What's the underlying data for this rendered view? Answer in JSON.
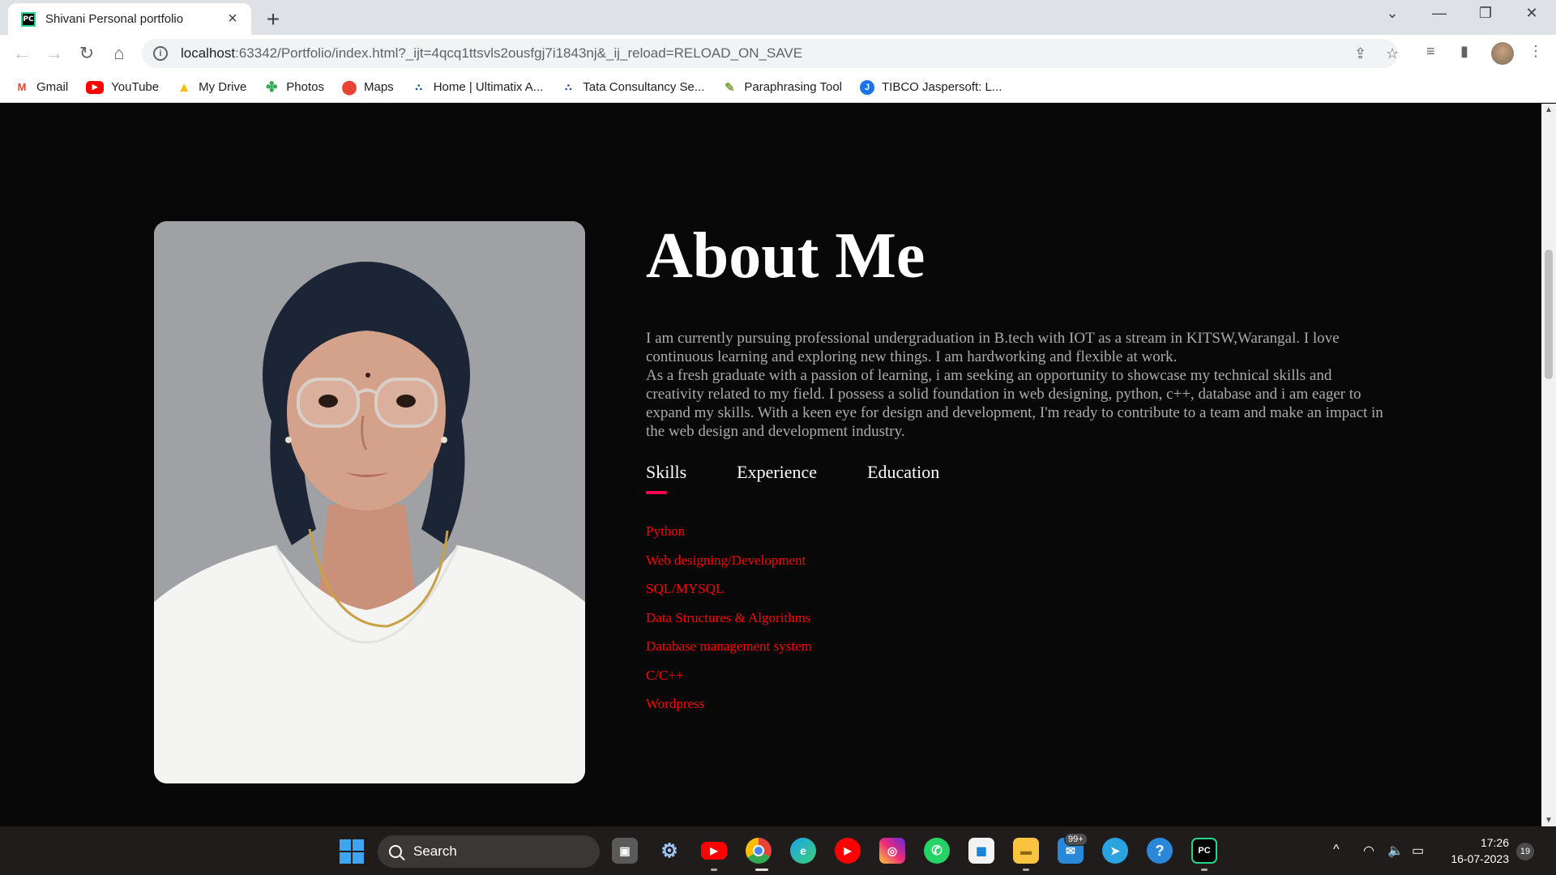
{
  "browser": {
    "tab_title": "Shivani Personal portfolio",
    "tab_favicon": "PC",
    "url_host": "localhost",
    "url_rest": ":63342/Portfolio/index.html?_ijt=4qcq1ttsvls2ousfgj7i1843nj&_ij_reload=RELOAD_ON_SAVE",
    "bookmarks": [
      {
        "label": "Gmail",
        "icon": "gmail-icon"
      },
      {
        "label": "YouTube",
        "icon": "youtube-icon"
      },
      {
        "label": "My Drive",
        "icon": "drive-icon"
      },
      {
        "label": "Photos",
        "icon": "photos-icon"
      },
      {
        "label": "Maps",
        "icon": "maps-icon"
      },
      {
        "label": "Home | Ultimatix A...",
        "icon": "tata-icon"
      },
      {
        "label": "Tata Consultancy Se...",
        "icon": "tata-icon"
      },
      {
        "label": "Paraphrasing Tool",
        "icon": "quillbot-icon"
      },
      {
        "label": "TIBCO Jaspersoft: L...",
        "icon": "jaspersoft-icon"
      }
    ]
  },
  "about": {
    "heading": "About Me",
    "paragraph": "I am currently pursuing professional undergraduation in B.tech with IOT as a stream in KITSW,Warangal. I love continuous learning and exploring new things. I am hardworking and flexible at work.",
    "paragraph2": "As a fresh graduate with a passion of learning, i am seeking an opportunity to showcase my technical skills and creativity related to my field. I possess a solid foundation in web designing, python, c++, database and i am eager to expand my skills. With a keen eye for design and development, I'm ready to contribute to a team and make an impact in the web design and development industry.",
    "tabs": [
      "Skills",
      "Experience",
      "Education"
    ],
    "active_tab": "Skills",
    "skills": [
      "Python",
      "Web designing/Development",
      "SQL/MYSQL",
      "Data Structures & Algorithms",
      "Database management system",
      "C/C++",
      "Wordpress"
    ],
    "accent_color": "#ff004f",
    "skill_color": "#ff0000"
  },
  "taskbar": {
    "search_label": "Search",
    "mail_badge": "99+",
    "time": "17:26",
    "date": "16-07-2023",
    "notifications": "19"
  }
}
